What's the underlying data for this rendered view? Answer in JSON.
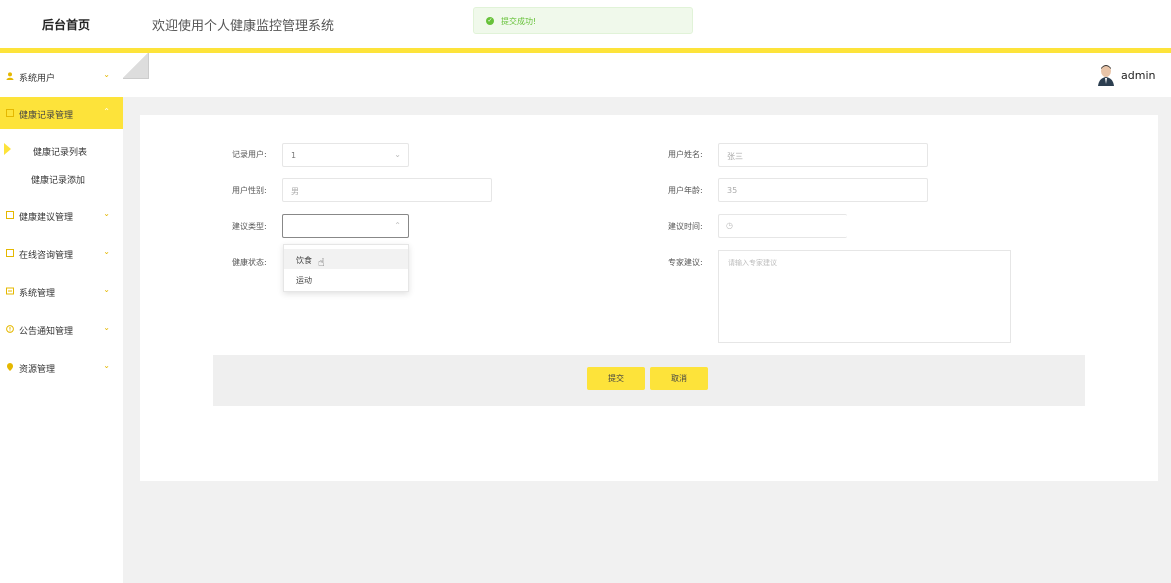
{
  "header": {
    "home_label": "后台首页",
    "welcome_text": "欢迎使用个人健康监控管理系统"
  },
  "toast": {
    "message": "提交成功!",
    "icon": "check-circle-icon"
  },
  "sidebar": {
    "items": [
      {
        "label": "系统用户",
        "icon": "user-icon"
      },
      {
        "label": "健康记录管理",
        "icon": "folder-icon"
      },
      {
        "label": "健康建议管理",
        "icon": "folder-icon"
      },
      {
        "label": "在线咨询管理",
        "icon": "folder-icon"
      },
      {
        "label": "系统管理",
        "icon": "settings-icon"
      },
      {
        "label": "公告通知管理",
        "icon": "info-icon"
      },
      {
        "label": "资源管理",
        "icon": "location-icon"
      }
    ],
    "sub_items": [
      {
        "label": "健康记录列表"
      },
      {
        "label": "健康记录添加"
      }
    ],
    "accent_color": "#fde33a"
  },
  "user": {
    "name": "admin"
  },
  "form": {
    "record_user_label": "记录用户:",
    "record_user_value": "1",
    "user_name_label": "用户姓名:",
    "user_name_value": "张三",
    "user_gender_label": "用户性别:",
    "user_gender_value": "男",
    "user_age_label": "用户年龄:",
    "user_age_value": "35",
    "advice_type_label": "建议类型:",
    "advice_time_label": "建议时间:",
    "health_status_label": "健康状态:",
    "expert_advice_label": "专家建议:",
    "expert_advice_placeholder": "请输入专家建议",
    "advice_type_options": [
      "饮食",
      "运动"
    ]
  },
  "buttons": {
    "submit": "提交",
    "cancel": "取消"
  }
}
